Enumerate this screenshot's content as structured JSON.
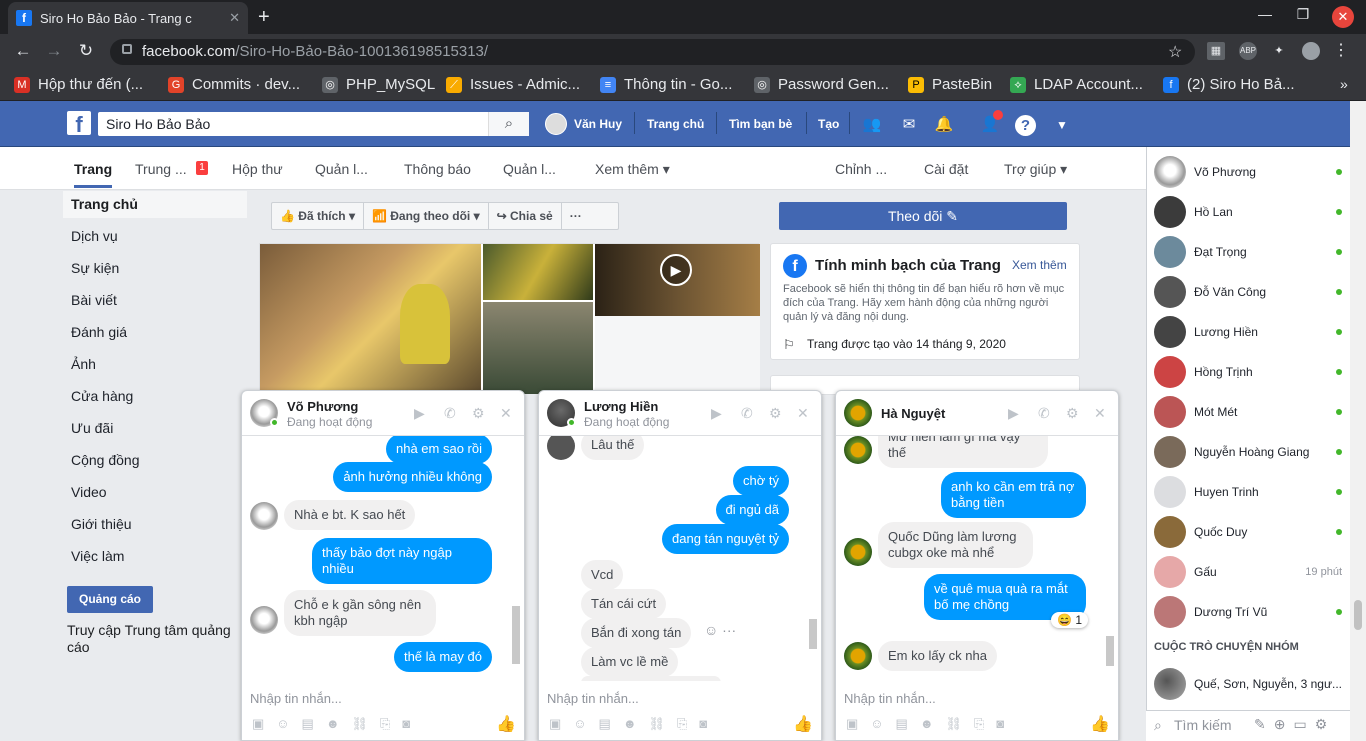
{
  "browser": {
    "tab_title": "Siro Ho Bảo Bảo - Trang c",
    "url_host": "facebook.com",
    "url_path": "/Siro-Ho-Bảo-Bảo-100136198515313/",
    "bookmarks": [
      {
        "label": "Hộp thư đến (...",
        "icon_color": "#d93025",
        "icon": "M"
      },
      {
        "label": "Commits · dev...",
        "icon_color": "#e24329",
        "icon": "G"
      },
      {
        "label": "PHP_MySQL",
        "icon_color": "#5f6368",
        "icon": "◎"
      },
      {
        "label": "Issues - Admic...",
        "icon_color": "#f9ab00",
        "icon": "⟋"
      },
      {
        "label": "Thông tin - Go...",
        "icon_color": "#4285f4",
        "icon": "≡"
      },
      {
        "label": "Password Gen...",
        "icon_color": "#5f6368",
        "icon": "◎"
      },
      {
        "label": "PasteBin",
        "icon_color": "#fbbc04",
        "icon": "P"
      },
      {
        "label": "LDAP Account...",
        "icon_color": "#34a853",
        "icon": "⟡"
      },
      {
        "label": "(2) Siro Ho Bả...",
        "icon_color": "#1877f2",
        "icon": "f"
      }
    ]
  },
  "fb": {
    "search_value": "Siro Ho Bảo Bảo",
    "user_name": "Văn Huy",
    "home": "Trang chủ",
    "find_friends": "Tìm bạn bè",
    "create": "Tạo"
  },
  "page_nav": {
    "items": [
      "Trang",
      "Trung ...",
      "Hộp thư",
      "Quản l...",
      "Thông báo",
      "Quản l...",
      "Xem thêm ▾",
      "Chỉnh ...",
      "Cài đặt",
      "Trợ giúp ▾"
    ],
    "badge": "1"
  },
  "left_nav": {
    "home": "Trang chủ",
    "items": [
      "Dịch vụ",
      "Sự kiện",
      "Bài viết",
      "Đánh giá",
      "Ảnh",
      "Cửa hàng",
      "Ưu đãi",
      "Cộng đồng",
      "Video",
      "Giới thiệu",
      "Việc làm"
    ],
    "ad_button": "Quảng cáo",
    "ad_link": "Truy cập Trung tâm quảng cáo"
  },
  "actions": {
    "liked": "Đã thích",
    "following": "Đang theo dõi",
    "share": "Chia sẻ",
    "more": "···",
    "follow": "Theo dõi"
  },
  "transparency": {
    "title": "Tính minh bạch của Trang",
    "more": "Xem thêm",
    "body": "Facebook sẽ hiển thị thông tin để bạn hiểu rõ hơn về mục đích của Trang. Hãy xem hành động của những người quản lý và đăng nội dung.",
    "created": "Trang được tạo vào 14 tháng 9, 2020"
  },
  "contacts": [
    {
      "name": "Võ Phương",
      "online": true
    },
    {
      "name": "Hồ Lan",
      "online": true
    },
    {
      "name": "Đạt Trọng",
      "online": true
    },
    {
      "name": "Đỗ Văn Công",
      "online": true
    },
    {
      "name": "Lương Hiền",
      "online": true
    },
    {
      "name": "Hồng Trịnh",
      "online": true
    },
    {
      "name": "Mót Mét",
      "online": true
    },
    {
      "name": "Nguyễn Hoàng Giang",
      "online": true
    },
    {
      "name": "Huyen Trinh",
      "online": true
    },
    {
      "name": "Quốc Duy",
      "online": true
    },
    {
      "name": "Gấu",
      "online": false,
      "time": "19 phút"
    },
    {
      "name": "Dương Trí Vũ",
      "online": true
    }
  ],
  "group_header": "CUỘC TRÒ CHUYỆN NHÓM",
  "group_item": "Quế, Sơn, Nguyễn, 3 ngư...",
  "sidebar_search": "Tìm kiếm",
  "chats": [
    {
      "name": "Võ Phương",
      "status": "Đang hoạt động",
      "input_placeholder": "Nhập tin nhắn...",
      "messages": [
        {
          "text": "nhà em sao rồi",
          "dir": "out"
        },
        {
          "text": "ảnh hưởng nhiều không",
          "dir": "out"
        },
        {
          "text": "Nhà e bt. K sao hết",
          "dir": "in"
        },
        {
          "text": "thấy bảo đợt này ngập nhiều",
          "dir": "out"
        },
        {
          "text": "Chỗ e k gần sông nên kbh ngập",
          "dir": "in"
        },
        {
          "text": "thế là may đó",
          "dir": "out"
        }
      ]
    },
    {
      "name": "Lương Hiền",
      "status": "Đang hoạt động",
      "input_placeholder": "Nhập tin nhắn...",
      "messages": [
        {
          "text": "Lâu thế",
          "dir": "in"
        },
        {
          "text": "chờ tý",
          "dir": "out"
        },
        {
          "text": "đi ngủ dã",
          "dir": "out"
        },
        {
          "text": "đang tán nguyệt tỷ",
          "dir": "out"
        },
        {
          "text": "Vcd",
          "dir": "in"
        },
        {
          "text": "Tán cái cứt",
          "dir": "in"
        },
        {
          "text": "Bắn đi xong tán",
          "dir": "in"
        },
        {
          "text": "Làm vc lề mề",
          "dir": "in"
        }
      ]
    },
    {
      "name": "Hà Nguyệt",
      "status": "",
      "input_placeholder": "Nhập tin nhắn...",
      "messages": [
        {
          "text": "Mư hiền làm gì mà vậy thế",
          "dir": "in"
        },
        {
          "text": "anh ko cần em trả nợ bằng tiền",
          "dir": "out"
        },
        {
          "text": "Quốc Dũng làm lương cubgx oke mà nhể",
          "dir": "in"
        },
        {
          "text": "về quê mua quà ra mắt bố mẹ chồng",
          "dir": "out"
        },
        {
          "text": "Em ko lấy ck nha",
          "dir": "in"
        }
      ],
      "reaction": "😄",
      "reaction_count": "1"
    }
  ]
}
